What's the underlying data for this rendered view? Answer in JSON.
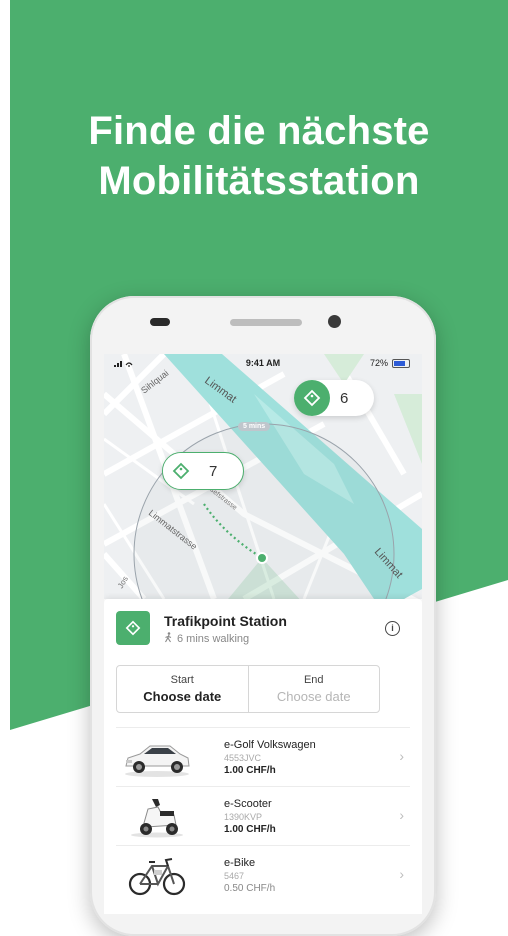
{
  "headline": {
    "line1": "Finde die nächste",
    "line2": "Mobilitätsstation"
  },
  "status_bar": {
    "time": "9:41 AM",
    "battery": "72%"
  },
  "map": {
    "labels": {
      "river_top": "Limmat",
      "river_bottom": "Limmat",
      "street_sihlquai": "Sihlquai",
      "street_limmatstrasse": "Limmatstrasse",
      "street_jos": "Jos",
      "street_mid": "Josefstrasse"
    },
    "clusters": [
      {
        "count": "6"
      },
      {
        "count": "7"
      }
    ],
    "walk_badge": "5 mins"
  },
  "station": {
    "name": "Trafikpoint Station",
    "walk_time": "6 mins walking"
  },
  "dates": {
    "start_label": "Start",
    "start_value": "Choose date",
    "end_label": "End",
    "end_value": "Choose date"
  },
  "vehicles": [
    {
      "name": "e-Golf Volkswagen",
      "plate": "4553JVC",
      "price": "1.00 CHF/h"
    },
    {
      "name": "e-Scooter",
      "plate": "1390KVP",
      "price": "1.00 CHF/h"
    },
    {
      "name": "e-Bike",
      "plate": "5467",
      "price": "0.50 CHF/h"
    }
  ],
  "colors": {
    "brand_green": "#4caf6e",
    "river": "#9fe0dc",
    "map_bg": "#eef0f2"
  }
}
